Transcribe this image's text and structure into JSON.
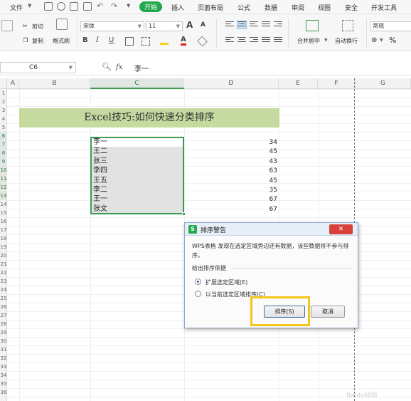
{
  "menu": {
    "file": "文件",
    "tabs": [
      "开始",
      "插入",
      "页面布局",
      "公式",
      "数据",
      "审阅",
      "视图",
      "安全",
      "开发工具"
    ],
    "active_tab": "开始"
  },
  "ribbon": {
    "cut": "剪切",
    "copy": "复制",
    "format_painter": "格式刷",
    "font_name": "宋体",
    "font_size": "11",
    "merge_center": "合并居中",
    "wrap_text": "自动换行",
    "number_format": "常规",
    "bold": "B",
    "italic": "I",
    "underline": "U",
    "font_grow": "A",
    "font_shrink": "A",
    "font_color": "A",
    "percent": "%"
  },
  "formula_bar": {
    "cell_ref": "C6",
    "fx": "fx",
    "content": "李一"
  },
  "sheet": {
    "columns": [
      "A",
      "B",
      "C",
      "D",
      "E",
      "F",
      "G"
    ],
    "selected_column": "C",
    "rows": [
      "1",
      "2",
      "3",
      "4",
      "5",
      "6",
      "7",
      "8",
      "9",
      "10",
      "11",
      "12",
      "13",
      "14",
      "15",
      "16",
      "17",
      "18",
      "19",
      "20",
      "21",
      "22",
      "23",
      "24",
      "25",
      "26",
      "27",
      "28",
      "29",
      "30",
      "31",
      "32",
      "33",
      "34",
      "35",
      "36"
    ],
    "title": "Excel技巧:如何快速分类排序",
    "data": [
      {
        "name": "李一",
        "value": "34"
      },
      {
        "name": "王二",
        "value": "45"
      },
      {
        "name": "张三",
        "value": "43"
      },
      {
        "name": "李四",
        "value": "63"
      },
      {
        "name": "王五",
        "value": "45"
      },
      {
        "name": "李二",
        "value": "35"
      },
      {
        "name": "王一",
        "value": "67"
      },
      {
        "name": "张文",
        "value": "67"
      }
    ]
  },
  "dialog": {
    "logo": "S",
    "title": "排序警告",
    "message": "WPS表格 发现在选定区域旁边还有数据，该些数据将不参与排序。",
    "group_label": "给出排序依据",
    "options": [
      "扩展选定区域(E)",
      "以当前选定区域排序(C)"
    ],
    "selected_option": 0,
    "sort_button": "排序(S)",
    "cancel_button": "取消"
  },
  "watermark": "Baidu经验",
  "colors": {
    "accent_green": "#22a84d",
    "title_fill": "#c5da9f",
    "selection_border": "#3c9b52",
    "highlight_box": "#f5c518",
    "close_red": "#d8403a"
  }
}
